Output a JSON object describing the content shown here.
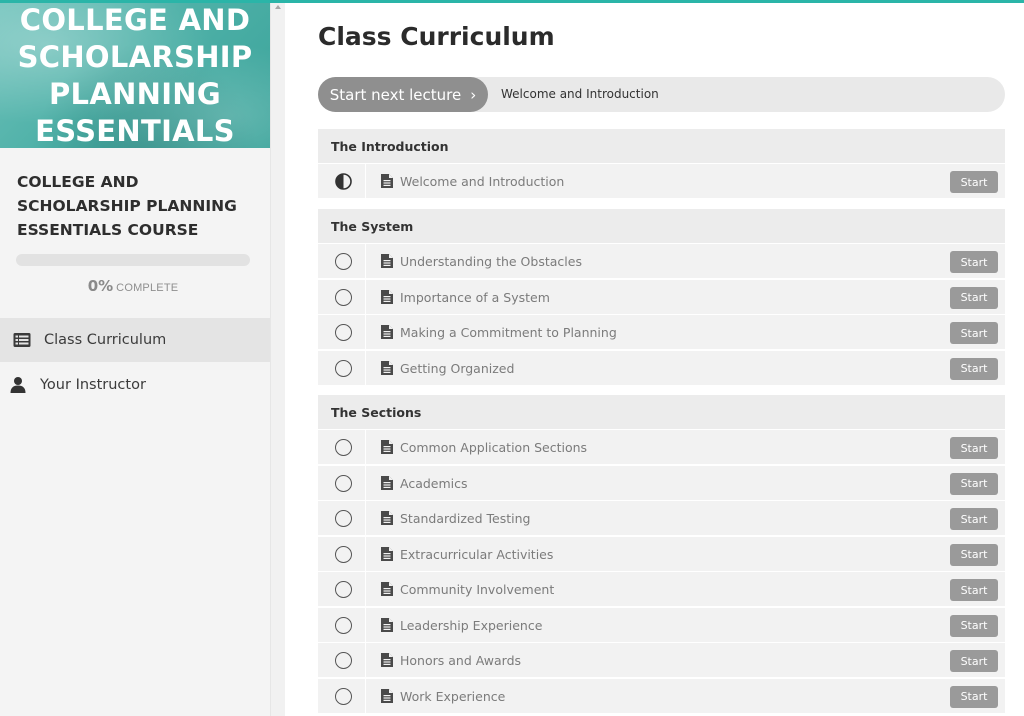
{
  "course": {
    "hero_title_lines": [
      "COLLEGE AND",
      "SCHOLARSHIP",
      "PLANNING",
      "ESSENTIALS"
    ],
    "name_lines": [
      "COLLEGE AND",
      "SCHOLARSHIP PLANNING",
      "ESSENTIALS COURSE"
    ],
    "progress_percent": 0,
    "progress_text": "0%",
    "progress_word": "COMPLETE"
  },
  "nav": {
    "items": [
      {
        "label": "Class Curriculum",
        "icon": "list-icon",
        "active": true
      },
      {
        "label": "Your Instructor",
        "icon": "user-icon",
        "active": false
      }
    ]
  },
  "main": {
    "title": "Class Curriculum",
    "next_button_label": "Start next lecture",
    "next_button_chevron": "›",
    "next_lecture_title": "Welcome and Introduction",
    "start_label": "Start",
    "sections": [
      {
        "title": "The Introduction",
        "lectures": [
          {
            "title": "Welcome and Introduction",
            "status": "in-progress"
          }
        ]
      },
      {
        "title": "The System",
        "lectures": [
          {
            "title": "Understanding the Obstacles",
            "status": "not-started"
          },
          {
            "title": "Importance of a System",
            "status": "not-started"
          },
          {
            "title": "Making a Commitment to Planning",
            "status": "not-started"
          },
          {
            "title": "Getting Organized",
            "status": "not-started"
          }
        ]
      },
      {
        "title": "The Sections",
        "lectures": [
          {
            "title": "Common Application Sections",
            "status": "not-started"
          },
          {
            "title": "Academics",
            "status": "not-started"
          },
          {
            "title": "Standardized Testing",
            "status": "not-started"
          },
          {
            "title": "Extracurricular Activities",
            "status": "not-started"
          },
          {
            "title": "Community Involvement",
            "status": "not-started"
          },
          {
            "title": "Leadership Experience",
            "status": "not-started"
          },
          {
            "title": "Honors and Awards",
            "status": "not-started"
          },
          {
            "title": "Work Experience",
            "status": "not-started"
          }
        ]
      }
    ]
  },
  "colors": {
    "accent": "#2ab5a8",
    "button_gray": "#9a9a9a"
  }
}
